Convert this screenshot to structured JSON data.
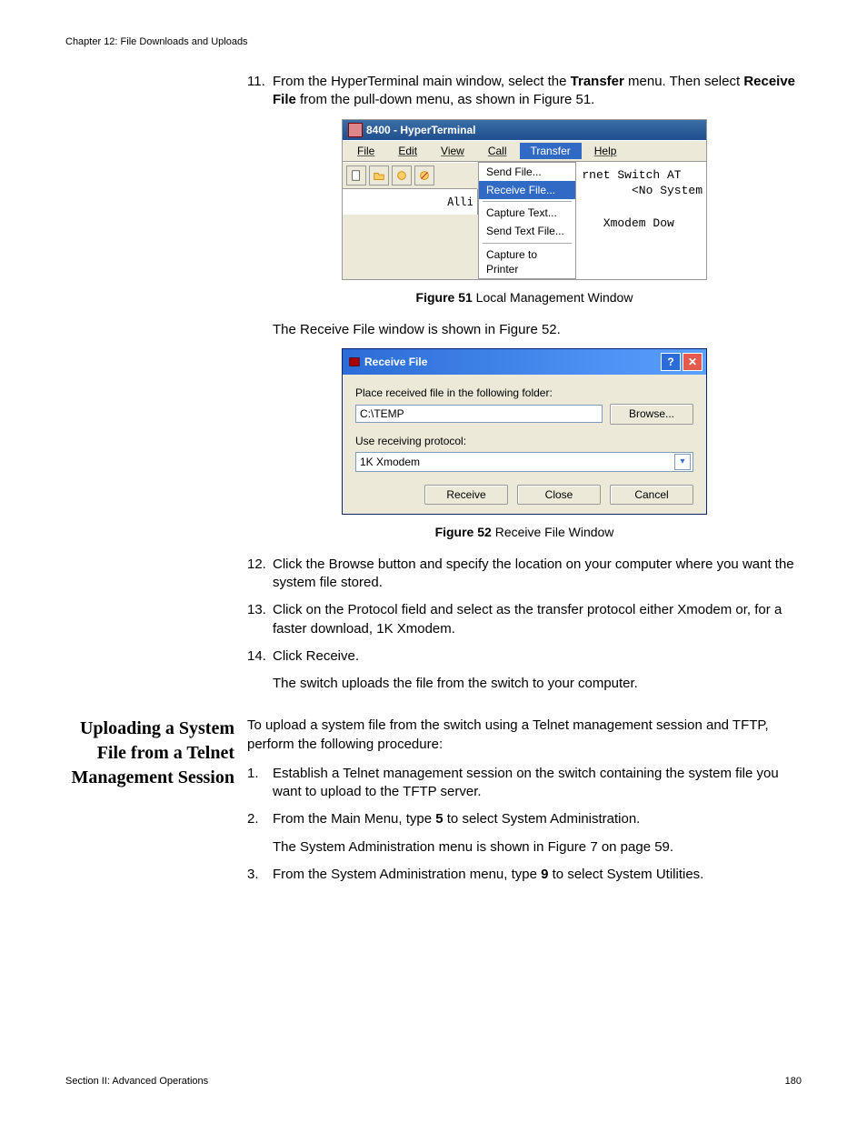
{
  "header": {
    "chapter": "Chapter 12: File Downloads and Uploads"
  },
  "footer": {
    "section": "Section II: Advanced Operations",
    "page": "180"
  },
  "steps_a": {
    "s11_num": "11.",
    "s11_a": "From the HyperTerminal main window, select the ",
    "s11_b": "Transfer",
    "s11_c": " menu. Then select ",
    "s11_d": "Receive File",
    "s11_e": " from the pull-down menu, as shown in Figure 51.",
    "s12_num": "12.",
    "s12": "Click the Browse button and specify the location on your computer where you want the system file stored.",
    "s13_num": "13.",
    "s13": "Click on the Protocol field and select as the transfer protocol either Xmodem or, for a faster download, 1K Xmodem.",
    "s14_num": "14.",
    "s14": "Click Receive.",
    "s14_after": "The switch uploads the file from the switch to your computer."
  },
  "between_figs": "The Receive File window is shown in Figure 52.",
  "fig51": {
    "label": "Figure 51",
    "caption": " Local Management Window"
  },
  "fig52": {
    "label": "Figure 52",
    "caption": " Receive File Window"
  },
  "hyper": {
    "title": "8400 - HyperTerminal",
    "menu": {
      "file": "File",
      "edit": "Edit",
      "view": "View",
      "call": "Call",
      "transfer": "Transfer",
      "help": "Help"
    },
    "toolbar_left": "Alli",
    "dropdown": {
      "send": "Send File...",
      "receive": "Receive File...",
      "capture_text": "Capture Text...",
      "send_text": "Send Text File...",
      "capture_printer": "Capture to Printer"
    },
    "right_text": "rnet Switch AT\n       <No System\n\n   Xmodem Dow"
  },
  "receive": {
    "title": "Receive File",
    "label_folder": "Place received file in the following folder:",
    "folder_value": "C:\\TEMP",
    "browse": "Browse...",
    "label_protocol": "Use receiving protocol:",
    "protocol_value": "1K Xmodem",
    "btn_receive": "Receive",
    "btn_close": "Close",
    "btn_cancel": "Cancel"
  },
  "section": {
    "heading": "Uploading a System File from a Telnet Management Session",
    "intro": "To upload a system file from the switch using a Telnet management session and TFTP, perform the following procedure:",
    "s1_num": "1.",
    "s1": "Establish a Telnet management session on the switch containing the system file you want to upload to the TFTP server.",
    "s2_num": "2.",
    "s2_a": "From the Main Menu, type ",
    "s2_b": "5",
    "s2_c": " to select System Administration.",
    "s2_after": "The System Administration menu is shown in Figure 7 on page 59.",
    "s3_num": "3.",
    "s3_a": "From the System Administration menu, type ",
    "s3_b": "9",
    "s3_c": " to select System Utilities."
  }
}
